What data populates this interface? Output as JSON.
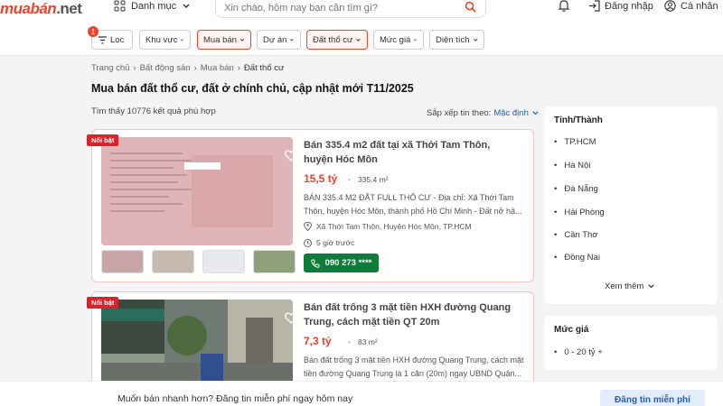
{
  "header": {
    "logo_main": "muabán",
    "logo_tld": ".net",
    "category_label": "Danh mục",
    "search_placeholder": "Xin chào, hôm nay bạn cần tìm gì?",
    "login_label": "Đăng nhập",
    "personal_label": "Cá nhân"
  },
  "filters": {
    "badge_count": "1",
    "items": [
      {
        "label": "Lọc",
        "active": false
      },
      {
        "label": "Khu vực",
        "active": false
      },
      {
        "label": "Mua bán",
        "active": true
      },
      {
        "label": "Dự án",
        "active": false
      },
      {
        "label": "Đất thổ cư",
        "active": true
      },
      {
        "label": "Mức giá",
        "active": false
      },
      {
        "label": "Diện tích",
        "active": false
      }
    ]
  },
  "breadcrumb": [
    "Trang chủ",
    "Bất động sản",
    "Mua bán",
    "Đất thổ cư"
  ],
  "page_title": "Mua bán đất thổ cư, đất ở chính chủ, cập nhật mới T11/2025",
  "result_count": "Tìm thấy 10776 kết quả phù hợp",
  "sort": {
    "label": "Sắp xếp tin theo:",
    "value": "Mặc định"
  },
  "listings": [
    {
      "ribbon": "Nổi bật",
      "title": "Bán 335.4 m2 đất tại xã Thới Tam Thôn, huyện Hóc Môn",
      "price": "15,5 tỷ",
      "area": "335.4 m²",
      "description": "BÁN 335.4 M2 ĐẤT FULL THỔ CƯ - Địa chỉ: Xã Thới Tam Thôn, huyện Hóc Môn, thành phố Hồ Chí Minh - Đất nở hậ...",
      "location": "Xã Thới Tam Thôn, Huyện Hóc Môn, TP.HCM",
      "posted": "5 giờ trước",
      "phone": "090 273 ****"
    },
    {
      "ribbon": "Nổi bật",
      "title": "Bán đất trống 3 mặt tiền HXH đường Quang Trung, cách mặt tiền QT 20m",
      "price": "7,3 tỷ",
      "area": "83 m²",
      "description": "Bán đất trống 3 mặt tiền HXH đường Quang Trung, cách mặt tiền đường Quang Trung là 1 căn (20m) ngay UBND Quận..."
    }
  ],
  "sidebar": {
    "province_title": "Tỉnh/Thành",
    "provinces": [
      "TP.HCM",
      "Hà Nội",
      "Đà Nẵng",
      "Hải Phòng",
      "Cần Thơ",
      "Đồng Nai"
    ],
    "more_label": "Xem thêm",
    "price_title": "Mức giá",
    "price_ranges": [
      "0 - 20 tỷ +"
    ]
  },
  "bottom_bar": {
    "message": "Muốn bán nhanh hơn? Đăng tin miễn phí ngay hôm nay",
    "button": "Đăng tin miễn phí"
  },
  "colors": {
    "brand": "#e8442e",
    "call": "#0e7d38",
    "link": "#1e5fc7"
  }
}
